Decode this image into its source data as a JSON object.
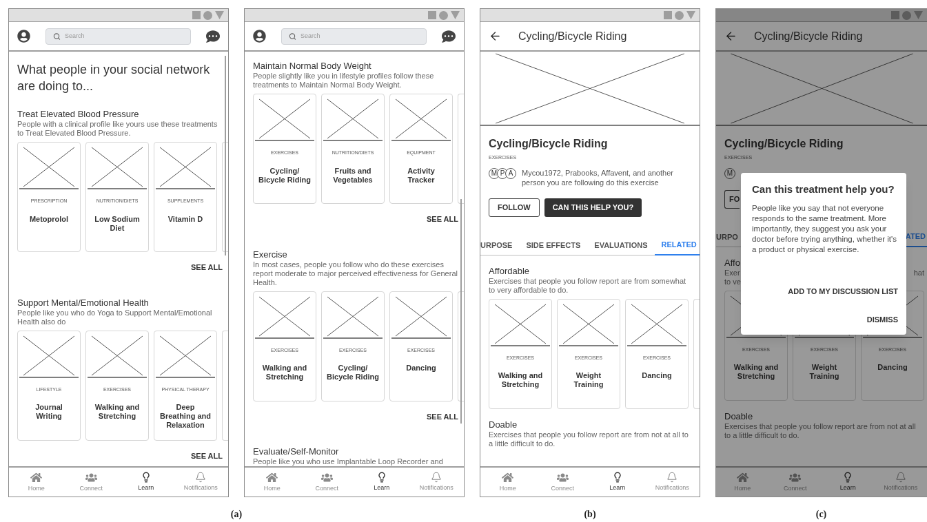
{
  "screens": [
    {
      "kind": "feed",
      "search_placeholder": "Search",
      "title": "What people in your social network are doing to...",
      "scrollbar": true,
      "sections": [
        {
          "title": "Treat Elevated Blood Pressure",
          "description": "People with a clinical profile like yours use these treatments to Treat Elevated Blood Pressure.",
          "cards": [
            {
              "category": "PRESCRIPTION",
              "name": "Metoprolol"
            },
            {
              "category": "NUTRITION/DIETS",
              "name": "Low Sodium Diet"
            },
            {
              "category": "SUPPLEMENTS",
              "name": "Vitamin D"
            }
          ],
          "see_all": "SEE ALL"
        },
        {
          "title": "Support Mental/Emotional Health",
          "description": "People like you who do Yoga to Support Mental/Emotional Health also do",
          "cards": [
            {
              "category": "LIFESTYLE",
              "name": "Journal Writing"
            },
            {
              "category": "EXERCISES",
              "name": "Walking and Stretching"
            },
            {
              "category": "PHYSICAL THERAPY",
              "name": "Deep\nBreathing and Relaxation"
            }
          ],
          "see_all": "SEE ALL"
        }
      ],
      "nav": [
        {
          "label": "Home",
          "selected": false
        },
        {
          "label": "Connect",
          "selected": false
        },
        {
          "label": "Learn",
          "selected": true
        },
        {
          "label": "Notifications",
          "selected": false
        }
      ]
    },
    {
      "kind": "feed",
      "search_placeholder": "Search",
      "scrollbar": true,
      "sections": [
        {
          "title": "Maintain Normal Body Weight",
          "description": "People slightly like you in lifestyle profiles follow these treatments to Maintain Normal Body Weight.",
          "cards": [
            {
              "category": "EXERCISES",
              "name": "Cycling/\nBicycle Riding"
            },
            {
              "category": "NUTRITION/DIETS",
              "name": "Fruits and Vegetables"
            },
            {
              "category": "EQUIPMENT",
              "name": "Activity Tracker"
            }
          ],
          "see_all": "SEE ALL"
        },
        {
          "title": "Exercise",
          "description": "In most cases, people you follow who do these exercises report moderate to major perceived effectiveness for General Health.",
          "cards": [
            {
              "category": "EXERCISES",
              "name": "Walking and Stretching"
            },
            {
              "category": "EXERCISES",
              "name": "Cycling/\nBicycle Riding"
            },
            {
              "category": "EXERCISES",
              "name": "Dancing"
            }
          ],
          "see_all": "SEE ALL"
        },
        {
          "title": "Evaluate/Self-Monitor",
          "description": "People like you who use Implantable Loop Recorder and"
        }
      ],
      "nav": [
        {
          "label": "Home",
          "selected": false
        },
        {
          "label": "Connect",
          "selected": false
        },
        {
          "label": "Learn",
          "selected": true
        },
        {
          "label": "Notifications",
          "selected": false
        }
      ]
    },
    {
      "kind": "detail",
      "dimmed": false,
      "header_title": "Cycling/Bicycle Riding",
      "heading": "Cycling/Bicycle Riding",
      "category": "EXERCISES",
      "avatars": [
        "M",
        "P",
        "A"
      ],
      "followers_text": "Mycou1972, Prabooks, Affavent, and another person you are following do this exercise",
      "buttons": [
        {
          "label": "FOLLOW",
          "kind": "outline"
        },
        {
          "label": "CAN THIS HELP YOU?",
          "kind": "filled"
        }
      ],
      "tabs": [
        {
          "label": "URPOSE",
          "selected": false
        },
        {
          "label": "SIDE EFFECTS",
          "selected": false
        },
        {
          "label": "EVALUATIONS",
          "selected": false
        },
        {
          "label": "RELATED",
          "selected": true
        }
      ],
      "sections": [
        {
          "title": "Affordable",
          "description": "Exercises that people you follow report are from somewhat to very affordable to do.",
          "cards": [
            {
              "category": "EXERCISES",
              "name": "Walking and Stretching"
            },
            {
              "category": "EXERCISES",
              "name": "Weight Training"
            },
            {
              "category": "EXERCISES",
              "name": "Dancing"
            }
          ]
        },
        {
          "title": "Doable",
          "description": "Exercises that people you follow report are from not at all to a little difficult to do."
        }
      ],
      "nav": [
        {
          "label": "Home",
          "selected": false
        },
        {
          "label": "Connect",
          "selected": false
        },
        {
          "label": "Learn",
          "selected": true
        },
        {
          "label": "Notifications",
          "selected": false
        }
      ]
    },
    {
      "kind": "detail",
      "dimmed": true,
      "header_title": "Cycling/Bicycle Riding",
      "heading": "Cycling/Bicycle Riding",
      "category": "EXERCISES",
      "avatars": [
        "M"
      ],
      "buttons": [
        {
          "label": "FO",
          "kind": "outline"
        }
      ],
      "tabs": [
        {
          "label": "URPO",
          "selected": false
        },
        {
          "label": "ATED",
          "selected": true
        }
      ],
      "sections": [
        {
          "title": "Affo",
          "description_lines": [
            "Exer",
            "to ve"
          ],
          "description_right": "hat",
          "cards": [
            {
              "category": "EXERCISES",
              "name": "Walking and Stretching"
            },
            {
              "category": "EXERCISES",
              "name": "Weight Training"
            },
            {
              "category": "EXERCISES",
              "name": "Dancing"
            }
          ]
        },
        {
          "title": "Doable",
          "description": "Exercises that people you follow report are from not at all to a little difficult to do."
        }
      ],
      "dialog": {
        "title": "Can this treatment help you?",
        "body": "People like you say that not everyone responds to the same treatment. More importantly, they suggest you ask your doctor before trying anything, whether it's a product or physical exercise.",
        "actions": [
          "ADD TO MY DISCUSSION LIST",
          "DISMISS"
        ]
      },
      "nav": [
        {
          "label": "Home",
          "selected": false
        },
        {
          "label": "Connect",
          "selected": false
        },
        {
          "label": "Learn",
          "selected": true
        },
        {
          "label": "Notifications",
          "selected": false
        }
      ]
    }
  ],
  "captions": [
    "(a)",
    "(b)",
    "(c)"
  ]
}
